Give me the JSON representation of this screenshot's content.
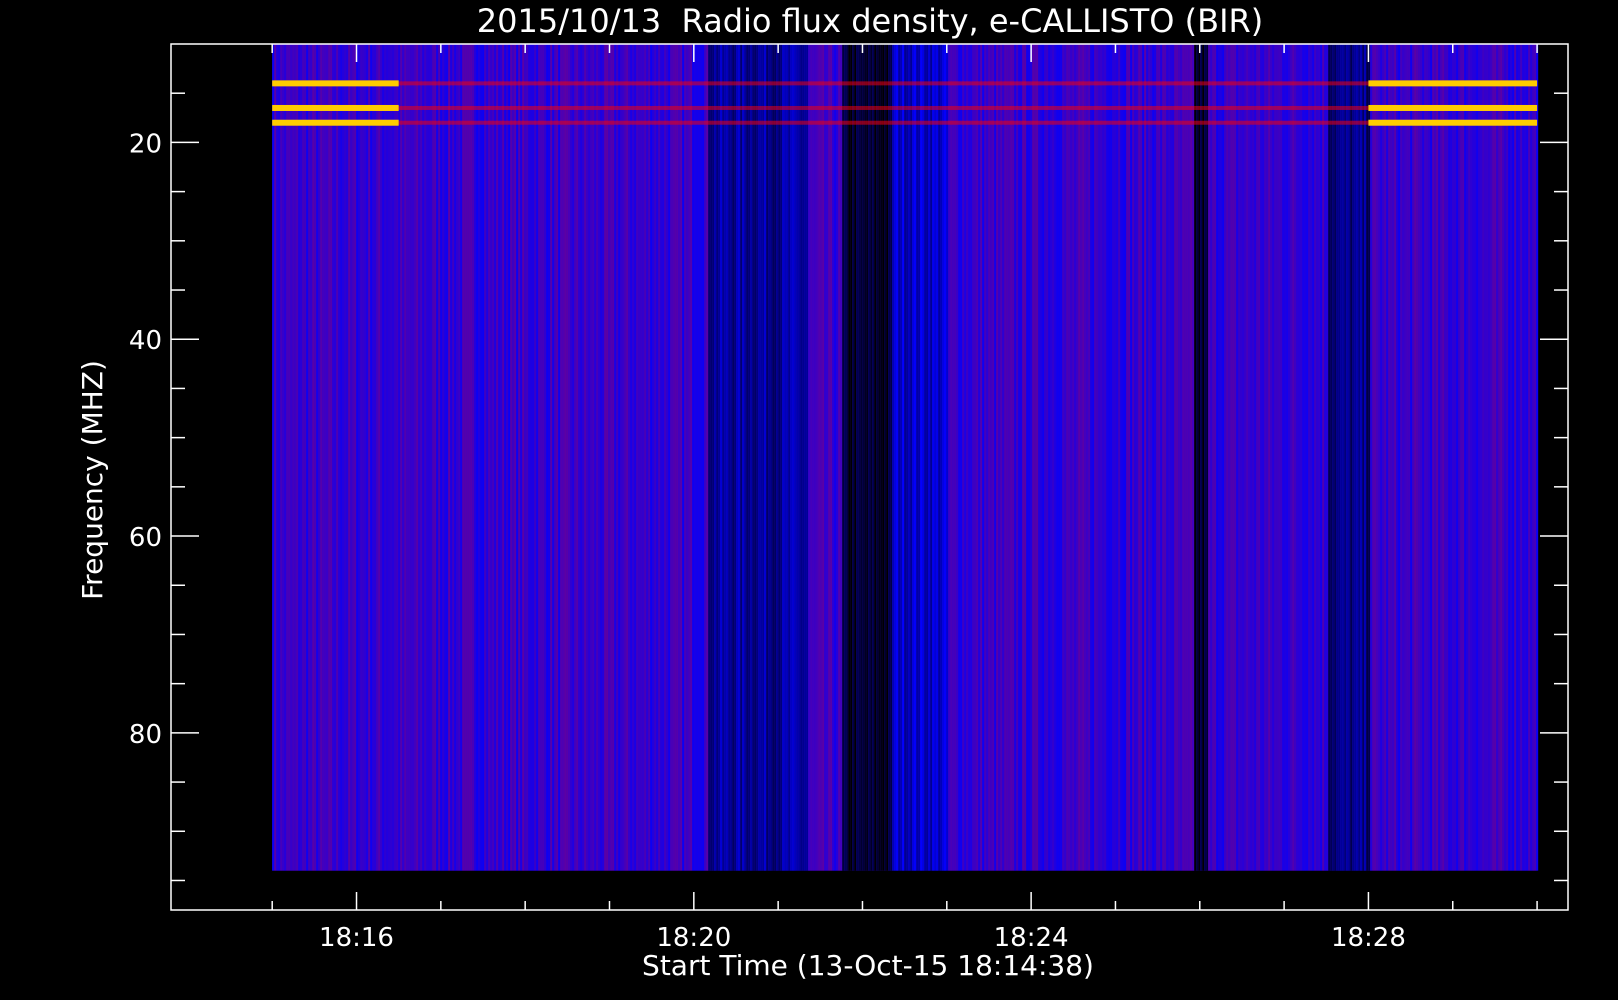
{
  "chart_data": {
    "type": "heatmap",
    "title": "2015/10/13  Radio flux density, e-CALLISTO (BIR)",
    "xlabel": "Start Time (13-Oct-15 18:14:38)",
    "ylabel": "Frequency (MHZ)",
    "x_unit": "minutes of day",
    "x_data_range": [
      "18:15",
      "18:30"
    ],
    "x_axis_range": [
      "18:13:48",
      "18:30:22"
    ],
    "y_data_range": [
      10,
      94
    ],
    "y_axis_range": [
      10,
      98
    ],
    "y_reversed": true,
    "x_major_ticks": [
      "18:16",
      "18:20",
      "18:24",
      "18:28"
    ],
    "x_minor_ticks": [
      "18:15",
      "18:16",
      "18:17",
      "18:18",
      "18:19",
      "18:20",
      "18:21",
      "18:22",
      "18:23",
      "18:24",
      "18:25",
      "18:26",
      "18:27",
      "18:28",
      "18:29",
      "18:30"
    ],
    "y_major_ticks": [
      20,
      40,
      60,
      80
    ],
    "y_minor_ticks": [
      15,
      20,
      25,
      30,
      35,
      40,
      45,
      50,
      55,
      60,
      65,
      70,
      75,
      80,
      85,
      90,
      95
    ],
    "colormap": [
      "#000000",
      "#0000ff",
      "#800080",
      "#ff0000",
      "#ffff00"
    ],
    "background_level": 0.35,
    "dark_bands": [
      {
        "start": "18:20:10",
        "end": "18:21:20",
        "level": 0.15
      },
      {
        "start": "18:21:45",
        "end": "18:22:20",
        "level": 0.03
      },
      {
        "start": "18:22:20",
        "end": "18:23:00",
        "level": 0.2
      },
      {
        "start": "18:25:55",
        "end": "18:26:05",
        "level": 0.03
      },
      {
        "start": "18:27:30",
        "end": "18:28:00",
        "level": 0.12
      }
    ],
    "bright_rows_mhz": [
      14,
      16.5,
      18
    ],
    "bright_row_spans": [
      {
        "start": "18:15",
        "end": "18:16:30",
        "level": 0.95
      },
      {
        "start": "18:28",
        "end": "18:30",
        "level": 0.95
      }
    ]
  }
}
